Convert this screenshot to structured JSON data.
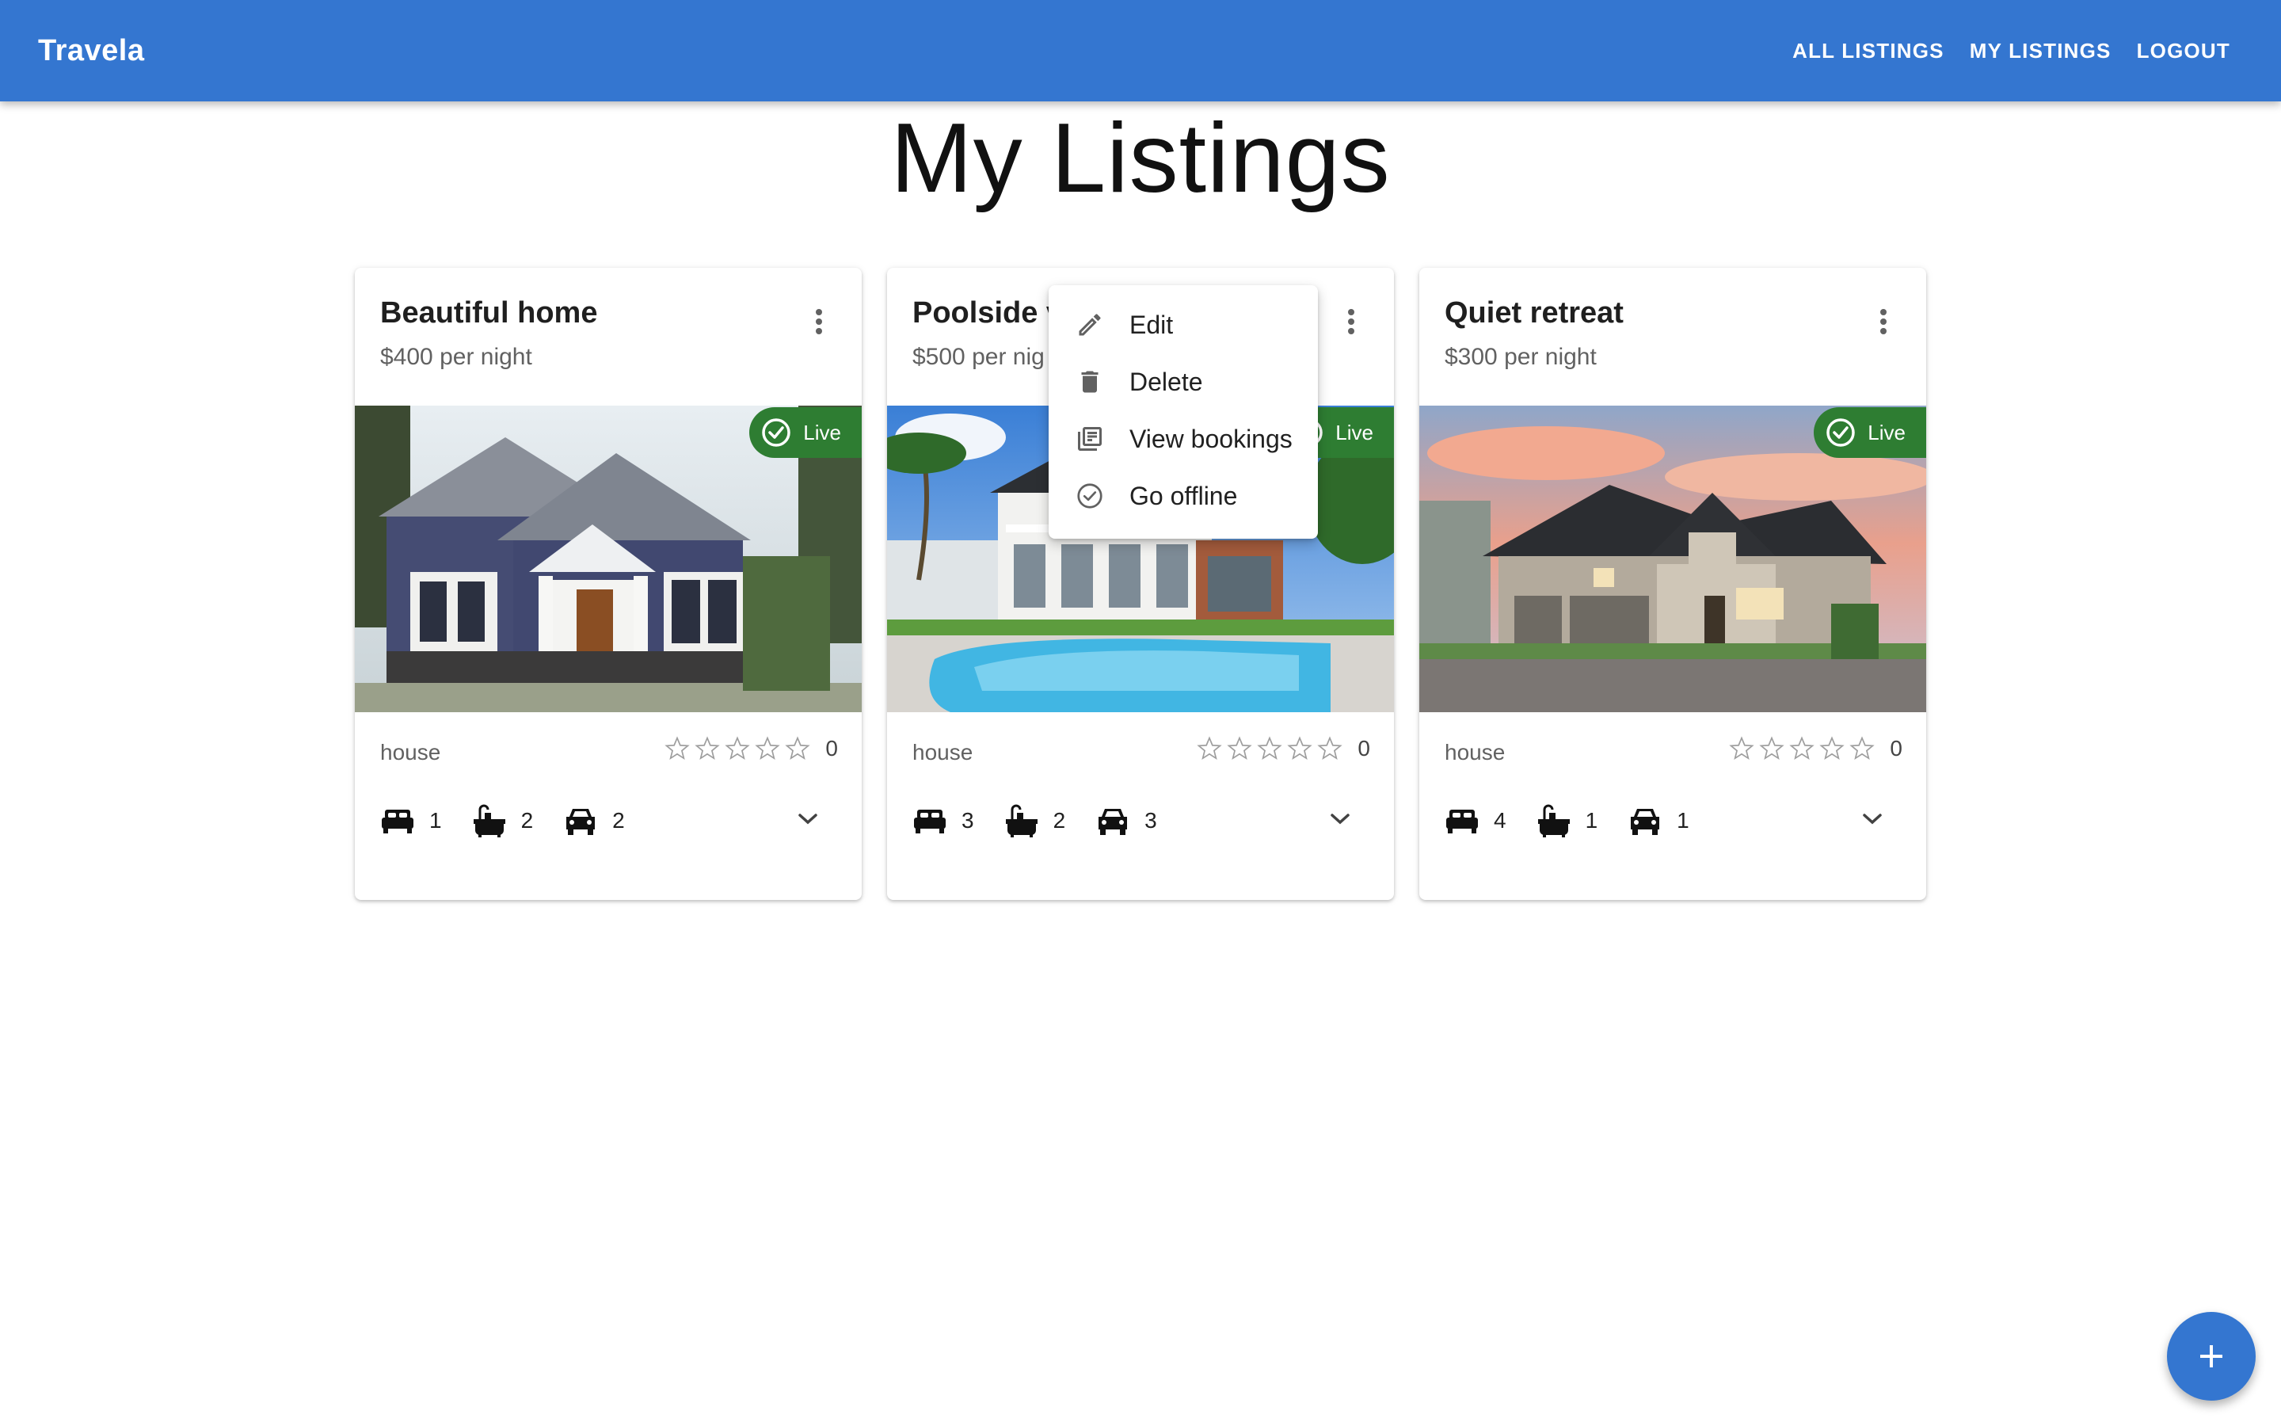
{
  "app": {
    "brand": "Travela"
  },
  "nav": {
    "all_listings": "ALL LISTINGS",
    "my_listings": "MY LISTINGS",
    "logout": "LOGOUT"
  },
  "page": {
    "title": "My Listings"
  },
  "colors": {
    "appbar": "#3476d0",
    "live_badge": "#2e7d32",
    "fab": "#3476d0"
  },
  "listings": [
    {
      "title": "Beautiful home",
      "price": "$400 per night",
      "status": "Live",
      "type": "house",
      "rating_stars": 0,
      "review_count": "0",
      "beds": "1",
      "baths": "2",
      "parking": "2",
      "image": "craftsman-house-photo"
    },
    {
      "title": "Poolside v",
      "price": "$500 per nig",
      "status": "Live",
      "type": "house",
      "rating_stars": 0,
      "review_count": "0",
      "beds": "3",
      "baths": "2",
      "parking": "3",
      "image": "poolside-villa-photo"
    },
    {
      "title": "Quiet retreat",
      "price": "$300 per night",
      "status": "Live",
      "type": "house",
      "rating_stars": 0,
      "review_count": "0",
      "beds": "4",
      "baths": "1",
      "parking": "1",
      "image": "suburban-house-sunset-photo"
    }
  ],
  "menu": {
    "items": [
      {
        "label": "Edit",
        "icon": "pencil-icon"
      },
      {
        "label": "Delete",
        "icon": "trash-icon"
      },
      {
        "label": "View bookings",
        "icon": "library-books-icon"
      },
      {
        "label": "Go offline",
        "icon": "check-circle-outline-icon"
      }
    ]
  },
  "icons": {
    "kebab": "more-vert-icon",
    "expand": "chevron-down-icon",
    "fab": "plus-icon",
    "beds": "bed-icon",
    "baths": "bathtub-icon",
    "parking": "car-icon",
    "rating": "star-outline-icon"
  }
}
